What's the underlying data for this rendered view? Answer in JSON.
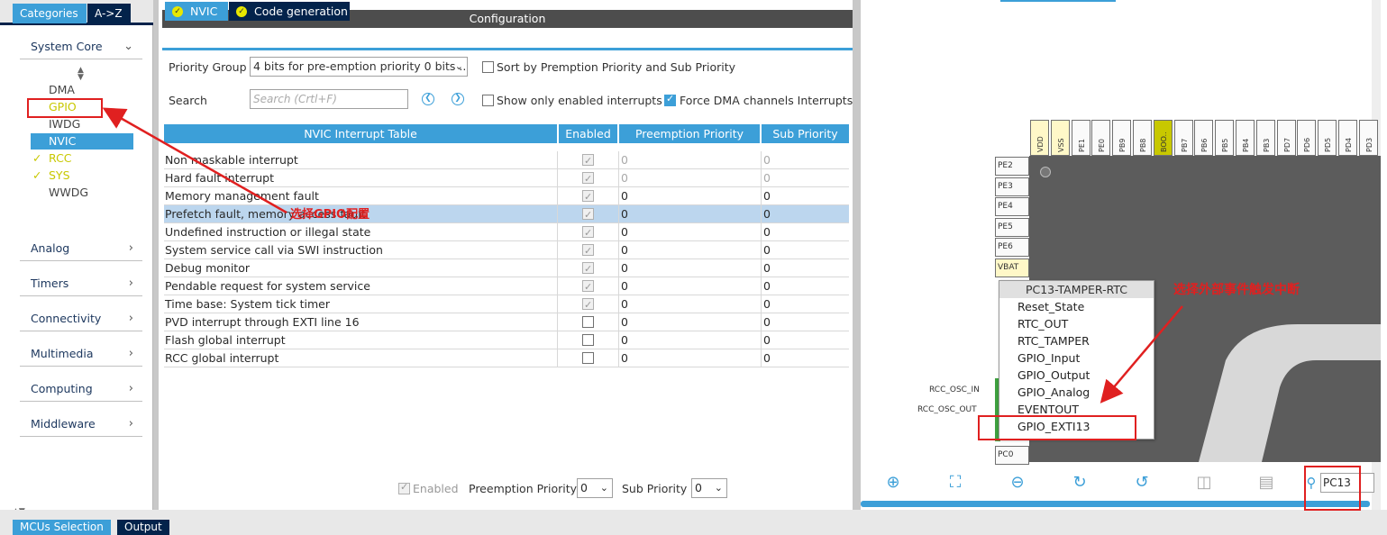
{
  "left_tabs": {
    "categories": "Categories",
    "az": "A->Z"
  },
  "categories": {
    "system_core": "System Core",
    "items": [
      "DMA",
      "GPIO",
      "IWDG",
      "NVIC",
      "RCC",
      "SYS",
      "WWDG"
    ],
    "analog": "Analog",
    "timers": "Timers",
    "connectivity": "Connectivity",
    "multimedia": "Multimedia",
    "computing": "Computing",
    "middleware": "Middleware"
  },
  "config": {
    "title": "Configuration",
    "tab_nvic": "NVIC",
    "tab_codegen": "Code generation",
    "priority_group_label": "Priority Group",
    "priority_group_value": "4 bits for pre-emption priority 0 bits ...",
    "sort_label": "Sort by Premption Priority and Sub Priority",
    "search_label": "Search",
    "search_placeholder": "Search (Crtl+F)",
    "show_enabled_label": "Show only enabled interrupts",
    "force_dma_label": "Force DMA channels Interrupts"
  },
  "table": {
    "headers": [
      "NVIC Interrupt Table",
      "Enabled",
      "Preemption Priority",
      "Sub Priority"
    ],
    "rows": [
      {
        "name": "Non maskable interrupt",
        "enabled": true,
        "pre": "0",
        "sub": "0"
      },
      {
        "name": "Hard fault interrupt",
        "enabled": true,
        "pre": "0",
        "sub": "0"
      },
      {
        "name": "Memory management fault",
        "enabled": true,
        "pre": "0",
        "sub": "0"
      },
      {
        "name": "Prefetch fault, memory access fault",
        "enabled": true,
        "pre": "0",
        "sub": "0"
      },
      {
        "name": "Undefined instruction or illegal state",
        "enabled": true,
        "pre": "0",
        "sub": "0"
      },
      {
        "name": "System service call via SWI instruction",
        "enabled": true,
        "pre": "0",
        "sub": "0"
      },
      {
        "name": "Debug monitor",
        "enabled": true,
        "pre": "0",
        "sub": "0"
      },
      {
        "name": "Pendable request for system service",
        "enabled": true,
        "pre": "0",
        "sub": "0"
      },
      {
        "name": "Time base: System tick timer",
        "enabled": true,
        "pre": "0",
        "sub": "0"
      },
      {
        "name": "PVD interrupt through EXTI line 16",
        "enabled": false,
        "pre": "0",
        "sub": "0"
      },
      {
        "name": "Flash global interrupt",
        "enabled": false,
        "pre": "0",
        "sub": "0"
      },
      {
        "name": "RCC global interrupt",
        "enabled": false,
        "pre": "0",
        "sub": "0"
      }
    ]
  },
  "bottom_controls": {
    "enabled_label": "Enabled",
    "preemption_label": "Preemption Priority",
    "preemption_value": "0",
    "sub_label": "Sub Priority",
    "sub_value": "0"
  },
  "pinout": {
    "top_pins": [
      "VDD",
      "VSS",
      "PE1",
      "PE0",
      "PB9",
      "PB8",
      "BOO..",
      "PB7",
      "PB6",
      "PB5",
      "PB4",
      "PB3",
      "PD7",
      "PD6",
      "PD5",
      "PD4",
      "PD3"
    ],
    "left_pins": [
      "PE2",
      "PE3",
      "PE4",
      "PE5",
      "PE6",
      "VBAT"
    ],
    "pc0": "PC0",
    "osc_in": "RCC_OSC_IN",
    "osc_out": "RCC_OSC_OUT",
    "menu_title": "PC13-TAMPER-RTC",
    "menu_items": [
      "Reset_State",
      "RTC_OUT",
      "RTC_TAMPER",
      "GPIO_Input",
      "GPIO_Output",
      "GPIO_Analog",
      "EVENTOUT",
      "GPIO_EXTI13"
    ],
    "search_value": "PC13"
  },
  "annotations": {
    "gpio_note": "选择GPIO配置",
    "exti_note": "选择外部事件触发中断"
  },
  "bottom_tabs": {
    "mcu": "MCUs Selection",
    "output": "Output"
  },
  "colors": {
    "accent": "#3c9fd8",
    "dark": "#03234b",
    "annotation": "#e02020"
  }
}
